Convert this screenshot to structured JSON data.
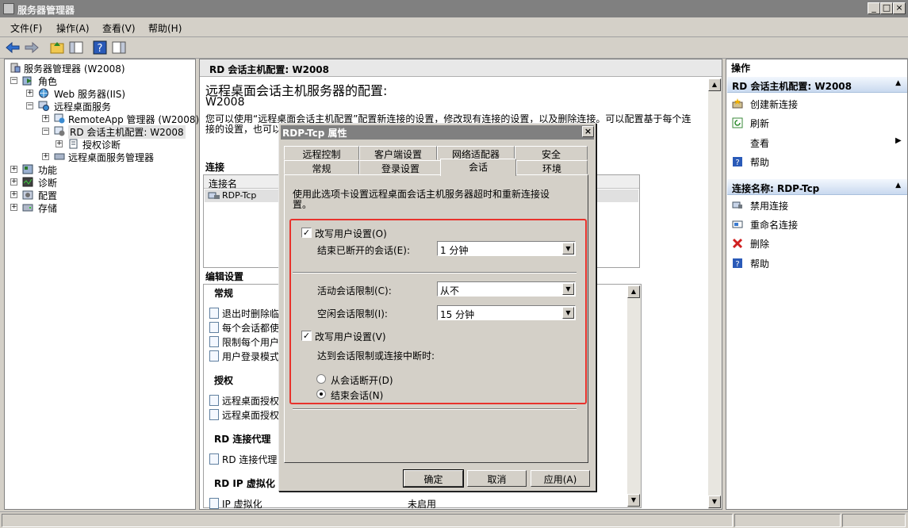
{
  "window": {
    "title": "服务器管理器",
    "buttons": [
      "_",
      "□",
      "×"
    ]
  },
  "menubar": [
    "文件(F)",
    "操作(A)",
    "查看(V)",
    "帮助(H)"
  ],
  "tree": {
    "root": "服务器管理器 (W2008)",
    "items": [
      "角色",
      "Web 服务器(IIS)",
      "远程桌面服务",
      "RemoteApp 管理器 (W2008)",
      "RD 会话主机配置: W2008",
      "授权诊断",
      "远程桌面服务管理器",
      "功能",
      "诊断",
      "配置",
      "存储"
    ]
  },
  "center": {
    "header": "RD 会话主机配置: W2008",
    "heading": "远程桌面会话主机服务器的配置:",
    "server": "W2008",
    "intro": "您可以使用“远程桌面会话主机配置”配置新连接的设置，修改现有连接的设置，以及删除连接。可以配置基于每个连",
    "intro2": "接的设置，也可以",
    "connections_title": "连接",
    "col_name": "连接名",
    "conn_row": "RDP-Tcp",
    "edit_title": "编辑设置",
    "groups": {
      "general": "常规",
      "general_items": [
        "退出时删除临",
        "每个会话都使",
        "限制每个用户",
        "用户登录模式"
      ],
      "licensing": "授权",
      "licensing_items": [
        "远程桌面授权",
        "远程桌面授权"
      ],
      "broker": "RD 连接代理",
      "broker_items": [
        "RD 连接代理"
      ],
      "ipv": "RD IP 虚拟化",
      "ipv_items": [
        "IP 虚拟化"
      ],
      "ipv_value": "未启用"
    }
  },
  "actions": {
    "title": "操作",
    "section1": "RD 会话主机配置: W2008",
    "items1": [
      "创建新连接",
      "刷新",
      "查看",
      "帮助"
    ],
    "section2": "连接名称: RDP-Tcp",
    "items2": [
      "禁用连接",
      "重命名连接",
      "删除",
      "帮助"
    ]
  },
  "dialog": {
    "title": "RDP-Tcp 属性",
    "tabs_row1": [
      "远程控制",
      "客户端设置",
      "网络适配器",
      "安全"
    ],
    "tabs_row2": [
      "常规",
      "登录设置",
      "会话",
      "环境"
    ],
    "active_tab": "会话",
    "description": "使用此选项卡设置远程桌面会话主机服务器超时和重新连接设",
    "description2": "置。",
    "override1": "改写用户设置(O)",
    "end_disconnected_label": "结束已断开的会话(E):",
    "end_disconnected_value": "1 分钟",
    "active_limit_label": "活动会话限制(C):",
    "active_limit_value": "从不",
    "idle_limit_label": "空闲会话限制(I):",
    "idle_limit_value": "15 分钟",
    "override2": "改写用户设置(V)",
    "limit_reached_label": "达到会话限制或连接中断时:",
    "radio_disconnect": "从会话断开(D)",
    "radio_end": "结束会话(N)",
    "ok": "确定",
    "cancel": "取消",
    "apply": "应用(A)",
    "close": "×"
  },
  "colors": {
    "highlight_border": "#e8322c",
    "action_header": "#c9d9ef"
  }
}
